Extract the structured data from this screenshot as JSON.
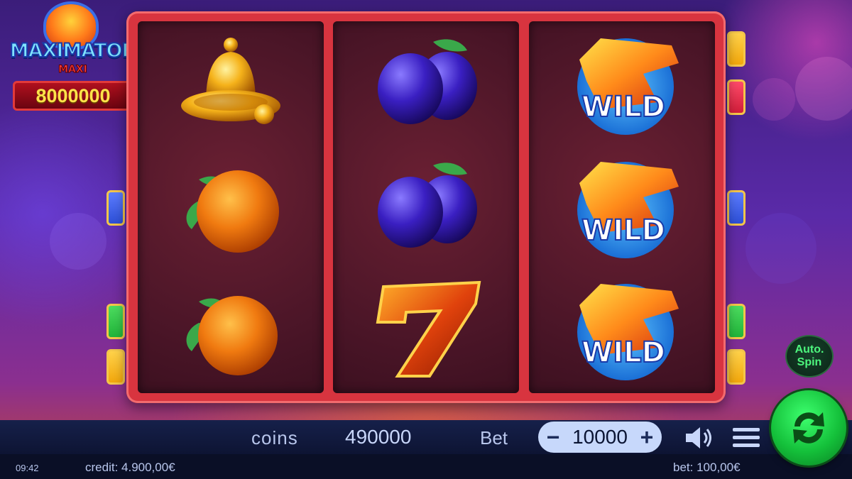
{
  "game": {
    "logo_title": "MAXIMATOR",
    "jackpot_label": "MAXI",
    "jackpot_value": "8000000"
  },
  "reels": [
    [
      "bell",
      "orange",
      "orange"
    ],
    [
      "plum",
      "plum",
      "seven"
    ],
    [
      "wild",
      "wild",
      "wild"
    ]
  ],
  "wild_label": "WILD",
  "payline_markers": {
    "left": [
      "blue",
      "green",
      "yellow"
    ],
    "right": [
      "yellow",
      "red",
      "blue",
      "green",
      "yellow"
    ]
  },
  "colors": {
    "marker_blue": "#2d4fd6",
    "marker_green": "#21b43a",
    "marker_yellow": "#f2a70c",
    "marker_red": "#d11e3a",
    "frame": "#d8343f",
    "spin_green": "#14c03a"
  },
  "controls": {
    "coins_label": "coins",
    "coins_value": "490000",
    "bet_label": "Bet",
    "bet_value": "10000",
    "bet_decrease": "−",
    "bet_increase": "+",
    "auto_spin_line1": "Auto.",
    "auto_spin_line2": "Spin",
    "sound_icon": "speaker-icon",
    "menu_icon": "hamburger-menu-icon",
    "spin_icon": "refresh-arrows-icon"
  },
  "status": {
    "time": "09:42",
    "credit": "credit: 4.900,00€",
    "bet": "bet: 100,00€"
  }
}
